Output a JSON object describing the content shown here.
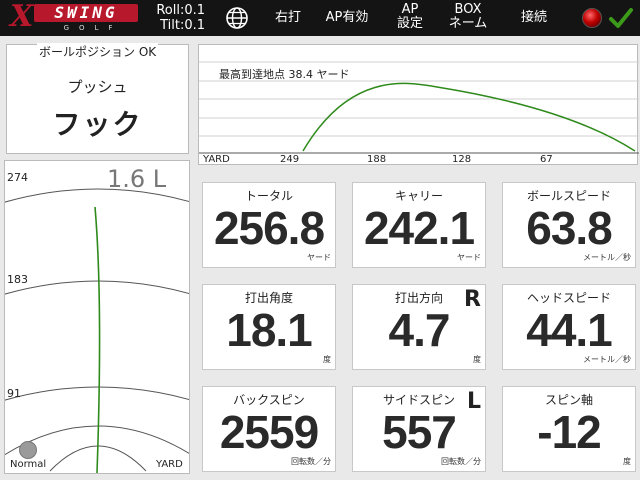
{
  "topbar": {
    "logo": {
      "mark": "X",
      "word": "SWING",
      "sub": "GOLF"
    },
    "roll": "Roll:0.1",
    "tilt": "Tilt:0.1",
    "language_icon": "globe-icon",
    "handedness": "右打",
    "ap_enabled": "AP有効",
    "ap_settings": [
      "AP",
      "設定"
    ],
    "box_name": [
      "BOX",
      "ネーム"
    ],
    "connect": "接続",
    "status_color": "#d10000",
    "confirm_color": "#3c9a1a"
  },
  "ball_position": {
    "title": "ボールポジション OK",
    "line1": "プッシュ",
    "line2": "フック"
  },
  "trajectory": {
    "peak_label": "最高到達地点 38.4 ヤード",
    "axis_unit": "YARD",
    "ticks": [
      "249",
      "188",
      "128",
      "67"
    ]
  },
  "dispersion": {
    "offset": "1.6 L",
    "labels": [
      "274",
      "183",
      "91"
    ],
    "mode": "Normal",
    "unit": "YARD"
  },
  "stats": [
    {
      "label": "トータル",
      "value": "256.8",
      "unit": "ヤード",
      "side": ""
    },
    {
      "label": "キャリー",
      "value": "242.1",
      "unit": "ヤード",
      "side": ""
    },
    {
      "label": "ボールスピード",
      "value": "63.8",
      "unit": "メートル／秒",
      "side": ""
    },
    {
      "label": "打出角度",
      "value": "18.1",
      "unit": "度",
      "side": ""
    },
    {
      "label": "打出方向",
      "value": "4.7",
      "unit": "度",
      "side": "R"
    },
    {
      "label": "ヘッドスピード",
      "value": "44.1",
      "unit": "メートル／秒",
      "side": ""
    },
    {
      "label": "バックスピン",
      "value": "2559",
      "unit": "回転数／分",
      "side": ""
    },
    {
      "label": "サイドスピン",
      "value": "557",
      "unit": "回転数／分",
      "side": "L"
    },
    {
      "label": "スピン軸",
      "value": "-12",
      "unit": "度",
      "side": ""
    }
  ],
  "colors": {
    "trace": "#2f8a1c",
    "grid": "#c8c8c8"
  }
}
